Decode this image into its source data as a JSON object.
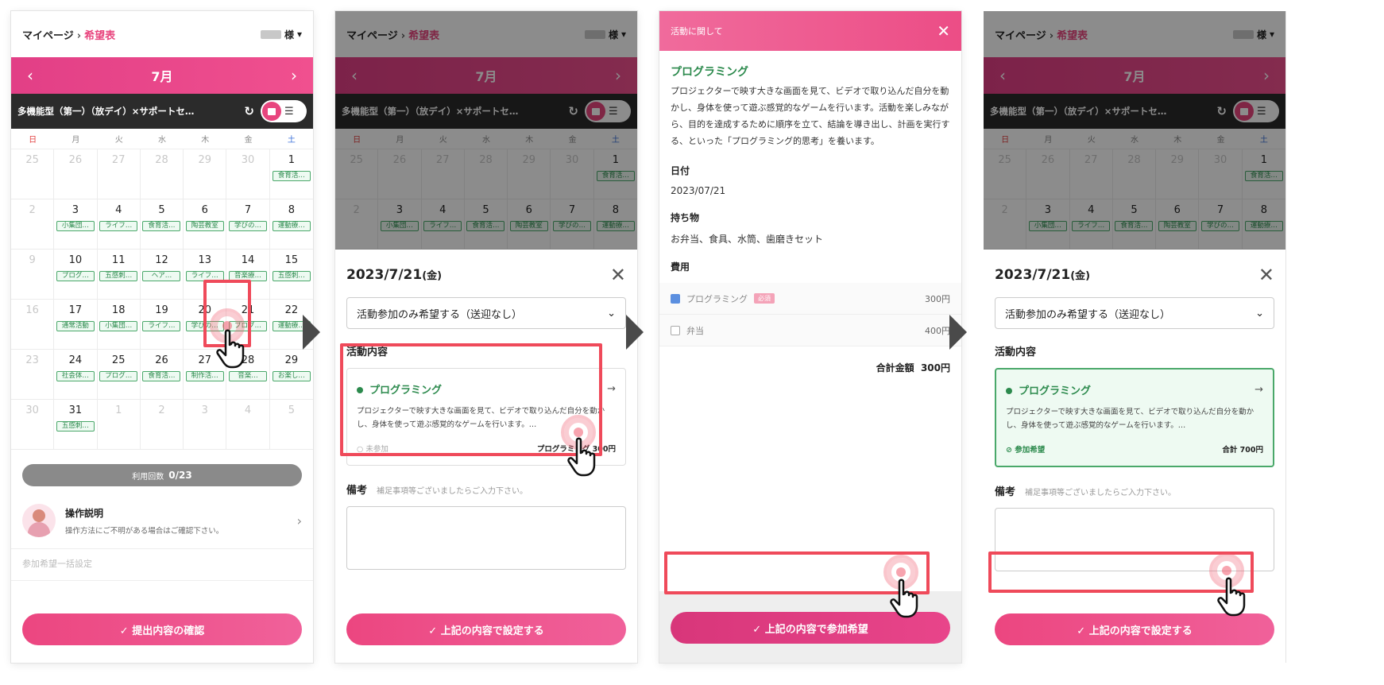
{
  "screen1": {
    "breadcrumb": {
      "home": "マイページ",
      "current": "希望表"
    },
    "user_suffix": "様",
    "month": "7月",
    "facility": "多機能型（第一）（放デイ）×サポートセ…",
    "weekdays": [
      "日",
      "月",
      "火",
      "水",
      "木",
      "金",
      "土"
    ],
    "days": [
      {
        "d": "25",
        "m": true
      },
      {
        "d": "26",
        "m": true
      },
      {
        "d": "27",
        "m": true
      },
      {
        "d": "28",
        "m": true
      },
      {
        "d": "29",
        "m": true
      },
      {
        "d": "30",
        "m": true
      },
      {
        "d": "1",
        "tag": "食育活…"
      },
      {
        "d": "2",
        "sun": true
      },
      {
        "d": "3",
        "tag": "小集団…"
      },
      {
        "d": "4",
        "tag": "ライフ…"
      },
      {
        "d": "5",
        "tag": "食育活…"
      },
      {
        "d": "6",
        "tag": "陶芸教室"
      },
      {
        "d": "7",
        "tag": "学びの…"
      },
      {
        "d": "8",
        "tag": "運動療…"
      },
      {
        "d": "9",
        "sun": true
      },
      {
        "d": "10",
        "tag": "プログ…"
      },
      {
        "d": "11",
        "tag": "五感刺…"
      },
      {
        "d": "12",
        "tag": "ヘア…"
      },
      {
        "d": "13",
        "tag": "ライフ…"
      },
      {
        "d": "14",
        "tag": "音楽療…"
      },
      {
        "d": "15",
        "tag": "五感刺…"
      },
      {
        "d": "16",
        "sun": true
      },
      {
        "d": "17",
        "tag": "通常活動"
      },
      {
        "d": "18",
        "tag": "小集団…"
      },
      {
        "d": "19",
        "tag": "ライフ…"
      },
      {
        "d": "20",
        "tag": "学びの…"
      },
      {
        "d": "21",
        "tag": "プログ…"
      },
      {
        "d": "22",
        "tag": "運動療…"
      },
      {
        "d": "23",
        "sun": true
      },
      {
        "d": "24",
        "tag": "社会体…"
      },
      {
        "d": "25",
        "tag": "プログ…"
      },
      {
        "d": "26",
        "tag": "食育活…"
      },
      {
        "d": "27",
        "tag": "制作活…"
      },
      {
        "d": "28",
        "tag": "音楽…"
      },
      {
        "d": "29",
        "tag": "お楽し…"
      },
      {
        "d": "30",
        "sun": true
      },
      {
        "d": "31",
        "tag": "五感刺…"
      },
      {
        "d": "1",
        "m": true
      },
      {
        "d": "2",
        "m": true
      },
      {
        "d": "3",
        "m": true
      },
      {
        "d": "4",
        "m": true
      },
      {
        "d": "5",
        "m": true
      }
    ],
    "usage_label": "利用回数",
    "usage_value": "0/23",
    "help_title": "操作説明",
    "help_desc": "操作方法にご不明がある場合はご確認下さい。",
    "help2": "参加希望一括設定",
    "confirm_button": "✓ 提出内容の確認"
  },
  "sheet": {
    "date": "2023/7/21",
    "weekday": "(金)",
    "select_value": "活動参加のみ希望する（送迎なし）",
    "section_title": "活動内容",
    "activity_title": "プログラミング",
    "activity_desc": "プロジェクターで映す大きな画面を見て、ビデオで取り込んだ自分を動かし、身体を使って遊ぶ感覚的なゲームを行います。…",
    "status_unjoined": "未参加",
    "price_label": "プログラミング 300円",
    "status_joined": "参加希望",
    "total_label": "合計 700円",
    "note_label": "備考",
    "note_placeholder": "補足事項等ございましたらご入力下さい。",
    "set_button": "✓ 上記の内容で設定する"
  },
  "modal": {
    "header": "活動に関して",
    "title": "プログラミング",
    "desc": "プロジェクターで映す大きな画面を見て、ビデオで取り込んだ自分を動かし、身体を使って遊ぶ感覚的なゲームを行います。活動を楽しみながら、目的を達成するために順序を立て、結論を導き出し、計画を実行する、といった「プログラミング的思考」を養います。",
    "date_label": "日付",
    "date_value": "2023/07/21",
    "items_label": "持ち物",
    "items_value": "お弁当、食具、水筒、歯磨きセット",
    "fee_label": "費用",
    "fees": [
      {
        "name": "プログラミング",
        "badge": "必須",
        "amount": "300円",
        "checked": true
      },
      {
        "name": "弁当",
        "badge": "",
        "amount": "400円",
        "checked": false
      }
    ],
    "total_label": "合計金額",
    "total_value": "300円",
    "apply_button": "✓ 上記の内容で参加希望"
  }
}
